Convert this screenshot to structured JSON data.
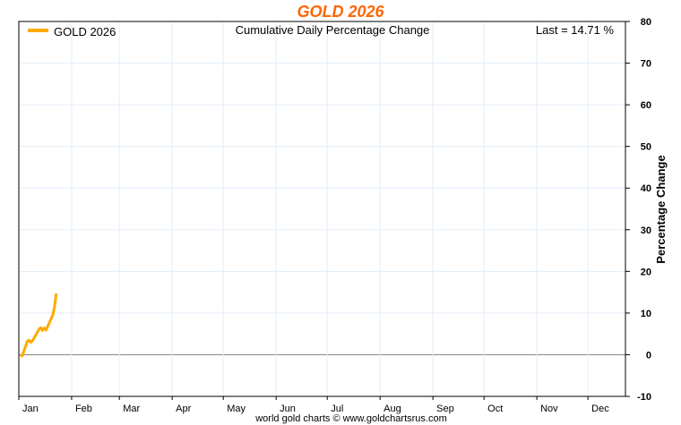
{
  "chart_data": {
    "type": "line",
    "title": "GOLD 2026",
    "subtitle": "Cumulative Daily Percentage Change",
    "last_label": "Last = 14.71 %",
    "ylabel": "Percentage Change",
    "xlabel": "",
    "footer": "world gold charts © www.goldchartsrus.com",
    "ylim": [
      -10,
      80
    ],
    "yticks": [
      -10,
      0,
      10,
      20,
      30,
      40,
      50,
      60,
      70,
      80
    ],
    "xlim_days": [
      0,
      356
    ],
    "months": [
      "Jan",
      "Feb",
      "Mar",
      "Apr",
      "May",
      "Jun",
      "Jul",
      "Aug",
      "Sep",
      "Oct",
      "Nov",
      "Dec"
    ],
    "month_start_days": [
      0,
      31,
      59,
      90,
      120,
      151,
      181,
      212,
      243,
      273,
      304,
      334
    ],
    "grid": true,
    "legend": "top-left",
    "series": [
      {
        "name": "GOLD 2026",
        "color": "#ffaa00",
        "x_day": [
          1,
          2,
          5,
          6,
          7,
          8,
          9,
          12,
          13,
          14,
          15,
          16,
          20,
          21,
          22
        ],
        "values": [
          0,
          -0.3,
          3.2,
          3.5,
          3.0,
          3.3,
          4.0,
          6.2,
          6.5,
          5.8,
          6.4,
          5.9,
          9.6,
          11.6,
          14.71
        ]
      }
    ],
    "colors": {
      "title": "#ff6600",
      "grid": "#e3eef8",
      "zero": "#888888"
    }
  }
}
